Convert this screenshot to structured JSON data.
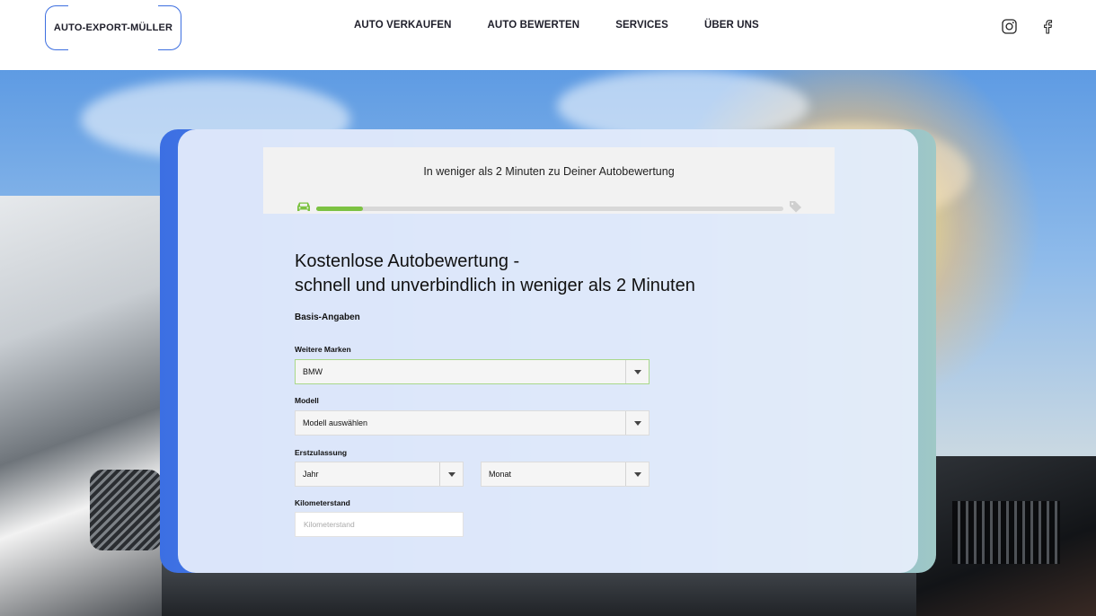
{
  "header": {
    "logo_text": "AUTO-EXPORT-MÜLLER",
    "nav": [
      {
        "label": "AUTO VERKAUFEN"
      },
      {
        "label": "AUTO BEWERTEN"
      },
      {
        "label": "SERVICES"
      },
      {
        "label": "ÜBER UNS"
      }
    ],
    "social": [
      "instagram-icon",
      "facebook-icon"
    ]
  },
  "progress": {
    "title": "In weniger als 2 Minuten zu Deiner Autobewertung",
    "percent": 10,
    "start_icon": "car-icon",
    "end_icon": "tag-icon",
    "fill_color": "#7cc242"
  },
  "form": {
    "heading_line1": "Kostenlose Autobewertung -",
    "heading_line2": "schnell und unverbindlich in weniger als 2 Minuten",
    "section_title": "Basis-Angaben",
    "marke": {
      "label": "Weitere Marken",
      "value": "BMW"
    },
    "modell": {
      "label": "Modell",
      "value": "Modell auswählen"
    },
    "erstzulassung": {
      "label": "Erstzulassung",
      "jahr": "Jahr",
      "monat": "Monat"
    },
    "kilometerstand": {
      "label": "Kilometerstand",
      "placeholder": "Kilometerstand"
    }
  },
  "colors": {
    "accent_blue": "#3d6fe0",
    "green": "#7cc242"
  }
}
